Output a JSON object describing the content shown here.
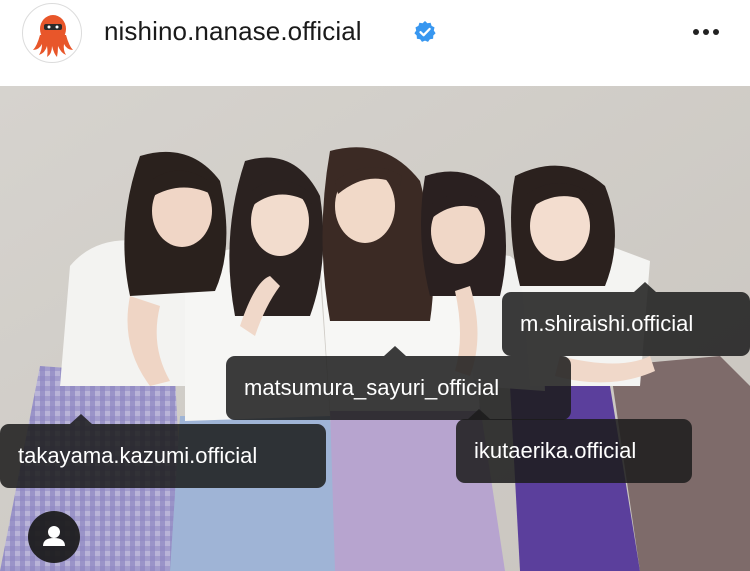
{
  "post": {
    "username": "nishino.nanase.official",
    "verified": true,
    "avatar_icon": "octopus-avatar-icon",
    "menu_icon": "more-horizontal-icon"
  },
  "photo_tags": [
    {
      "username": "m.shiraishi.official"
    },
    {
      "username": "matsumura_sayuri_official"
    },
    {
      "username": "ikutaerika.official"
    },
    {
      "username": "takayama.kazumi.official"
    }
  ],
  "colors": {
    "verified_blue": "#3897f0",
    "avatar_orange": "#e8562a",
    "tag_background": "#1c1c1c"
  },
  "tagged_people_icon": "person-icon"
}
